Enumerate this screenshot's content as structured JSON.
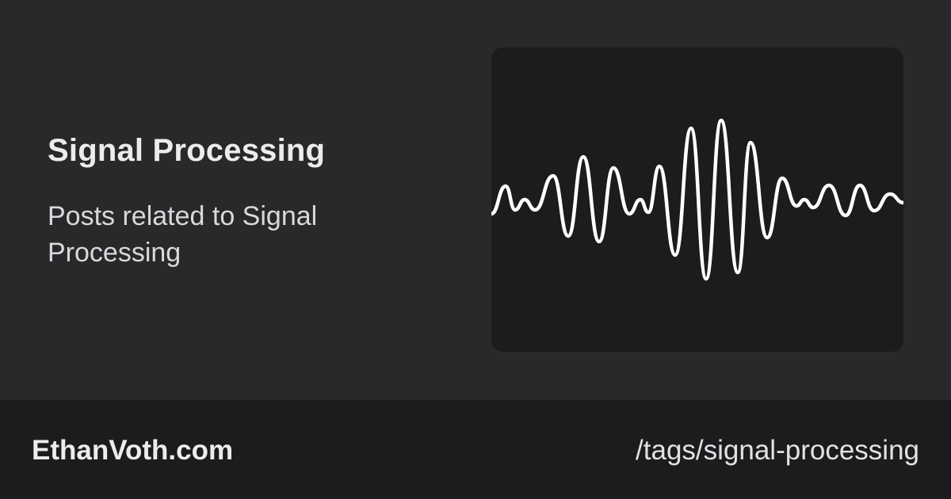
{
  "tag": {
    "title": "Signal Processing",
    "description": "Posts related to Signal Processing"
  },
  "illustration": {
    "icon": "waveform-icon",
    "stroke_color": "#ffffff",
    "background_color": "#1c1c1e"
  },
  "footer": {
    "site_name": "EthanVoth.com",
    "path": "/tags/signal-processing"
  },
  "colors": {
    "page_background": "#29292b",
    "footer_background": "#1c1c1e",
    "text": "#ececee"
  }
}
